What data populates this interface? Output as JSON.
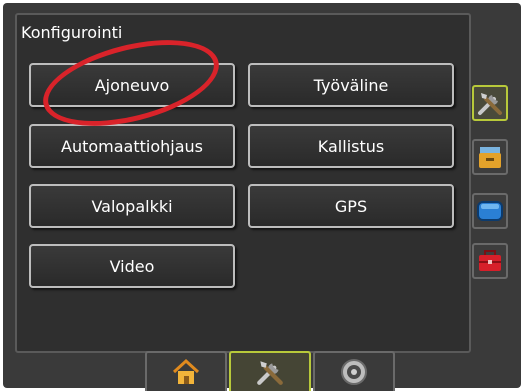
{
  "panel": {
    "title": "Konfigurointi",
    "buttons": [
      "Ajoneuvo",
      "Työväline",
      "Automaattiohjaus",
      "Kallistus",
      "Valopalkki",
      "GPS",
      "Video"
    ]
  },
  "side_tabs": [
    {
      "icon": "tools-icon",
      "active": true
    },
    {
      "icon": "file-cabinet-icon",
      "active": false
    },
    {
      "icon": "blue-screen-icon",
      "active": false
    },
    {
      "icon": "toolbox-icon",
      "active": false
    }
  ],
  "bottom_tabs": [
    {
      "icon": "home-icon",
      "active": false
    },
    {
      "icon": "tools-icon",
      "active": true
    },
    {
      "icon": "gauge-icon",
      "active": false
    }
  ],
  "colors": {
    "background": "#3a3a3a",
    "button_border": "#bdbdbd",
    "active_border": "#b8c93a",
    "annotation": "#d9232a"
  }
}
